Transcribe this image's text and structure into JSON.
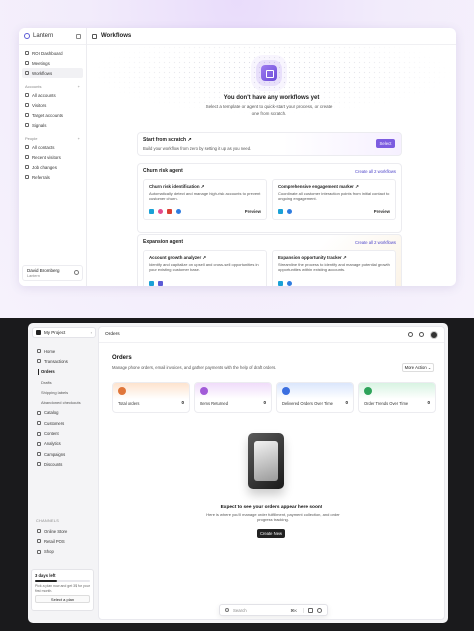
{
  "lantern": {
    "brand": "Lantern",
    "nav_main": [
      "ROI Dashboard",
      "Meetings",
      "Workflows"
    ],
    "accounts_label": "Accounts",
    "nav_accounts": [
      "All accounts",
      "Visitors",
      "Target accounts",
      "Signals"
    ],
    "people_label": "People",
    "nav_people": [
      "All contacts",
      "Recent visitors",
      "Job changes",
      "Referrals"
    ],
    "user_name": "David Bromberg",
    "user_org": "Lantern",
    "header_title": "Workflows",
    "empty_title": "You don't have any workflows yet",
    "empty_sub": "Select a template or agent to quick-start your process, or create one from scratch.",
    "scratch_title": "Start from scratch ↗",
    "scratch_sub": "Build your workflow from zero by setting it up as you need.",
    "select_label": "Select",
    "groups": [
      {
        "title": "Churn risk agent",
        "action": "Create all 2 workflows",
        "cards": [
          {
            "title": "Churn risk identification ↗",
            "desc": "Automatically detect and manage high-risk accounts to prevent customer churn.",
            "cta": "Preview"
          },
          {
            "title": "Comprehensive engagement marker ↗",
            "desc": "Coordinate all customer interaction points from initial contact to ongoing engagement.",
            "cta": "Preview"
          }
        ]
      },
      {
        "title": "Expansion agent",
        "action": "Create all 2 workflows",
        "cards": [
          {
            "title": "Account growth analyzer ↗",
            "desc": "Identify and capitalize on upsell and cross-sell opportunities in your existing customer base.",
            "cta": ""
          },
          {
            "title": "Expansion opportunity tracker ↗",
            "desc": "Streamline the process to identify and manage potential growth opportunities within existing accounts.",
            "cta": ""
          }
        ]
      }
    ]
  },
  "store": {
    "project": "My Project",
    "nav": [
      "Home",
      "Transactions",
      "Orders",
      "Drafts",
      "Shipping labels",
      "Abandoned checkouts",
      "Catalog",
      "Customers",
      "Content",
      "Analytics",
      "Campaigns",
      "Discounts"
    ],
    "channels_label": "CHANNELS",
    "channels": [
      "Online Store",
      "Retail POS",
      "Shop"
    ],
    "trial_title": "3 days left",
    "trial_desc": "Pick a plan now and get 3$ for your first month.",
    "trial_btn": "Select a plan",
    "header_title": "Orders",
    "page_title": "Orders",
    "page_sub": "Manage phone orders, email invoices, and gather payments with the help of draft orders.",
    "more_action": "More Action ⌄",
    "stats": [
      {
        "label": "Total orders",
        "value": "0",
        "color": "#e0763a",
        "glow": "#fde3cf"
      },
      {
        "label": "Items Returned",
        "value": "0",
        "color": "#a25bd8",
        "glow": "#f0dcfa"
      },
      {
        "label": "Delivered Orders Over Time",
        "value": "0",
        "color": "#3c6fe0",
        "glow": "#dbe6fc"
      },
      {
        "label": "Order Trends Over Time",
        "value": "0",
        "color": "#2ea35a",
        "glow": "#d8f3e2"
      }
    ],
    "empty_title": "Expect to see your orders appear here soon!",
    "empty_sub": "Here is where you'll manage order fulfillment, payment collection, and order progress tracking.",
    "create_label": "Create New",
    "search_placeholder": "Search",
    "search_kbd": "⌘K"
  }
}
